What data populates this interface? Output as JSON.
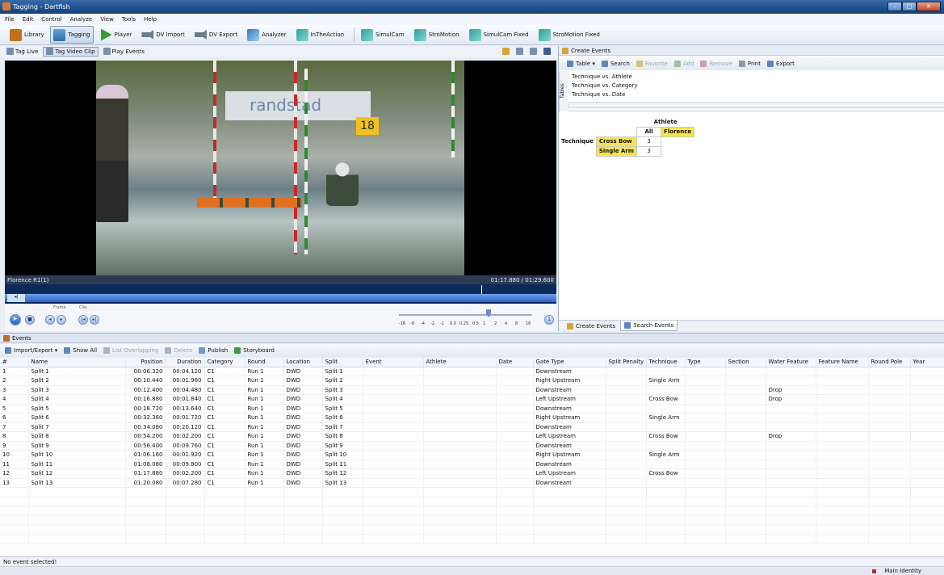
{
  "window": {
    "title": "Tagging - Dartfish",
    "min": "–",
    "max": "□",
    "close": "✕"
  },
  "menu": [
    "File",
    "Edit",
    "Control",
    "Analyze",
    "View",
    "Tools",
    "Help"
  ],
  "toolbar": {
    "items": [
      {
        "label": "Library",
        "icon": "book-icon"
      },
      {
        "label": "Tagging",
        "icon": "tagging-icon"
      },
      {
        "label": "Player",
        "icon": "play-icon"
      },
      {
        "label": "DV Import",
        "icon": "camera-icon"
      },
      {
        "label": "DV Export",
        "icon": "camera-icon"
      },
      {
        "label": "Analyzer",
        "icon": "analyzer-icon"
      },
      {
        "label": "InTheAction",
        "icon": "intheaction-icon"
      },
      {
        "label": "SimulCam",
        "icon": "simulcam-icon"
      },
      {
        "label": "StroMotion",
        "icon": "stromotion-icon"
      },
      {
        "label": "SimulCam Fixed",
        "icon": "simulcam-icon"
      },
      {
        "label": "StroMotion Fixed",
        "icon": "stromotion-icon"
      }
    ],
    "selected": "Tagging"
  },
  "subtoolbar": {
    "tag_live": "Tag Live",
    "tag_clip": "Tag Video Clip",
    "play_events": "Play Events"
  },
  "video": {
    "clip_name": "Florence R1(1)",
    "time": "01:17.880 / 01:29.600",
    "banner_text": "randstad",
    "sign_number": "18",
    "frame_label": "Frame",
    "clip_label": "Clip",
    "speed_labels": [
      "-16",
      "-8",
      "-4",
      "-2",
      "-1",
      "0.0",
      "0.25",
      "0.5",
      "1",
      "2",
      "4",
      "8",
      "16"
    ],
    "speed_marker": "1"
  },
  "right_panel": {
    "header": "Create Events",
    "toolbar": {
      "table": "Table ▾",
      "search": "Search",
      "favorite": "Favorite",
      "add": "Add",
      "remove": "Remove",
      "print": "Print",
      "export": "Export"
    },
    "tables_label": "Tables",
    "tables": [
      "Technique vs. Athlete",
      "Technique vs. Category",
      "Technique vs. Date"
    ],
    "pivot": {
      "col_header": "Athlete",
      "row_header": "Technique",
      "all": "All",
      "athlete": "Florence",
      "rows": [
        {
          "label": "Cross Bow",
          "value": "3"
        },
        {
          "label": "Single Arm",
          "value": "3"
        }
      ]
    },
    "tabs": [
      "Create Events",
      "Search Events"
    ]
  },
  "events": {
    "title": "Events",
    "toolbar": {
      "import_export": "Import/Export ▾",
      "show_all": "Show All",
      "list_overlapping": "List Overlapping",
      "delete": "Delete",
      "publish": "Publish",
      "storyboard": "Storyboard"
    },
    "columns": [
      "#",
      "Name",
      "Position",
      "Duration",
      "Category",
      "Round",
      "Location",
      "Split",
      "Event",
      "Athlete",
      "Date",
      "Gate Type",
      "Split Penalty",
      "Technique",
      "Type",
      "Section",
      "Water Feature",
      "Feature Name",
      "Round Pole",
      "Year"
    ],
    "rows": [
      [
        "1",
        "Split 1",
        "00:06.320",
        "00:04.120",
        "C1",
        "Run 1",
        "DWD",
        "Split 1",
        "",
        "",
        "",
        "Downstream",
        "",
        "",
        "",
        "",
        "",
        "",
        "",
        ""
      ],
      [
        "2",
        "Split 2",
        "00:10.440",
        "00:01.960",
        "C1",
        "Run 1",
        "DWD",
        "Split 2",
        "",
        "",
        "",
        "Right Upstream",
        "",
        "Single Arm",
        "",
        "",
        "",
        "",
        "",
        ""
      ],
      [
        "3",
        "Split 3",
        "00:12.400",
        "00:04.480",
        "C1",
        "Run 1",
        "DWD",
        "Split 3",
        "",
        "",
        "",
        "Downstream",
        "",
        "",
        "",
        "",
        "Drop",
        "",
        "",
        ""
      ],
      [
        "4",
        "Split 4",
        "00:16.880",
        "00:01.840",
        "C1",
        "Run 1",
        "DWD",
        "Split 4",
        "",
        "",
        "",
        "Left Upstream",
        "",
        "Cross Bow",
        "",
        "",
        "Drop",
        "",
        "",
        ""
      ],
      [
        "5",
        "Split 5",
        "00:18.720",
        "00:13.640",
        "C1",
        "Run 1",
        "DWD",
        "Split 5",
        "",
        "",
        "",
        "Downstream",
        "",
        "",
        "",
        "",
        "",
        "",
        "",
        ""
      ],
      [
        "6",
        "Split 6",
        "00:32.360",
        "00:01.720",
        "C1",
        "Run 1",
        "DWD",
        "Split 6",
        "",
        "",
        "",
        "Right Upstream",
        "",
        "Single Arm",
        "",
        "",
        "",
        "",
        "",
        ""
      ],
      [
        "7",
        "Split 7",
        "00:34.080",
        "00:20.120",
        "C1",
        "Run 1",
        "DWD",
        "Split 7",
        "",
        "",
        "",
        "Downstream",
        "",
        "",
        "",
        "",
        "",
        "",
        "",
        ""
      ],
      [
        "8",
        "Split 8",
        "00:54.200",
        "00:02.200",
        "C1",
        "Run 1",
        "DWD",
        "Split 8",
        "",
        "",
        "",
        "Left Upstream",
        "",
        "Cross Bow",
        "",
        "",
        "Drop",
        "",
        "",
        ""
      ],
      [
        "9",
        "Split 9",
        "00:56.400",
        "00:09.760",
        "C1",
        "Run 1",
        "DWD",
        "Split 9",
        "",
        "",
        "",
        "Downstream",
        "",
        "",
        "",
        "",
        "",
        "",
        "",
        ""
      ],
      [
        "10",
        "Split 10",
        "01:06.160",
        "00:01.920",
        "C1",
        "Run 1",
        "DWD",
        "Split 10",
        "",
        "",
        "",
        "Right Upstream",
        "",
        "Single Arm",
        "",
        "",
        "",
        "",
        "",
        ""
      ],
      [
        "11",
        "Split 11",
        "01:08.080",
        "00:09.800",
        "C1",
        "Run 1",
        "DWD",
        "Split 11",
        "",
        "",
        "",
        "Downstream",
        "",
        "",
        "",
        "",
        "",
        "",
        "",
        ""
      ],
      [
        "12",
        "Split 12",
        "01:17.880",
        "00:02.200",
        "C1",
        "Run 1",
        "DWD",
        "Split 12",
        "",
        "",
        "",
        "Left Upstream",
        "",
        "Cross Bow",
        "",
        "",
        "",
        "",
        "",
        ""
      ],
      [
        "13",
        "Split 13",
        "01:20.080",
        "00:07.280",
        "C1",
        "Run 1",
        "DWD",
        "Split 13",
        "",
        "",
        "",
        "Downstream",
        "",
        "",
        "",
        "",
        "",
        "",
        "",
        ""
      ]
    ],
    "sort_column": "Split",
    "sort_indicator": "⊥"
  },
  "status": {
    "message": "No event selected!",
    "identity": "Main Identity"
  }
}
